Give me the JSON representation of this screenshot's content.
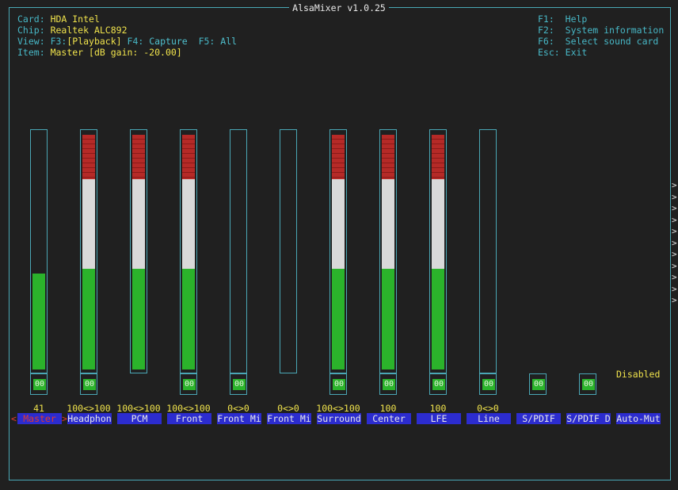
{
  "title": "AlsaMixer v1.0.25",
  "info": {
    "card_label": "Card:",
    "card_value": "HDA Intel",
    "chip_label": "Chip:",
    "chip_value": "Realtek ALC892",
    "view_label": "View:",
    "view_f3": "F3:",
    "view_playback": "[Playback]",
    "view_f4": "F4:",
    "view_capture": "Capture",
    "view_f5": "F5:",
    "view_all": "All",
    "item_label": "Item:",
    "item_value": "Master [dB gain: -20.00]"
  },
  "help": [
    {
      "key": "F1:",
      "text": "Help"
    },
    {
      "key": "F2:",
      "text": "System information"
    },
    {
      "key": "F6:",
      "text": "Select sound card"
    },
    {
      "key": "Esc:",
      "text": "Exit"
    }
  ],
  "channels": [
    {
      "name": "Master",
      "volume_text": "41",
      "switch": "00",
      "level_percent": 41,
      "selected": true
    },
    {
      "name": "Headphon",
      "volume_text": "100<>100",
      "switch": "00",
      "level_percent": 100
    },
    {
      "name": "PCM",
      "volume_text": "100<>100",
      "switch": "",
      "level_percent": 100
    },
    {
      "name": "Front",
      "volume_text": "100<>100",
      "switch": "00",
      "level_percent": 100
    },
    {
      "name": "Front Mi",
      "volume_text": "0<>0",
      "switch": "00",
      "level_percent": 0
    },
    {
      "name": "Front Mi",
      "volume_text": "0<>0",
      "switch": "",
      "level_percent": 0
    },
    {
      "name": "Surround",
      "volume_text": "100<>100",
      "switch": "00",
      "level_percent": 100
    },
    {
      "name": "Center",
      "volume_text": "100",
      "switch": "00",
      "level_percent": 100
    },
    {
      "name": "LFE",
      "volume_text": "100",
      "switch": "00",
      "level_percent": 100
    },
    {
      "name": "Line",
      "volume_text": "0<>0",
      "switch": "00",
      "level_percent": 0
    },
    {
      "name": "S/PDIF",
      "volume_text": "",
      "switch": "00",
      "level_percent": null
    },
    {
      "name": "S/PDIF D",
      "volume_text": "",
      "switch": "00",
      "level_percent": null
    },
    {
      "name": "Auto-Mut",
      "volume_text": "",
      "switch": "",
      "level_percent": null,
      "status": "Disabled"
    }
  ],
  "selection_arrows": {
    "left": "<",
    "right": ">"
  },
  "scroll_indicator": ">",
  "colors": {
    "border": "#4aa7b5",
    "label": "#47b7c6",
    "value": "#f0e34c",
    "red": "#b52a27",
    "white": "#d9d9d9",
    "green": "#2bb32b",
    "name_bg": "#2c2ccf"
  }
}
